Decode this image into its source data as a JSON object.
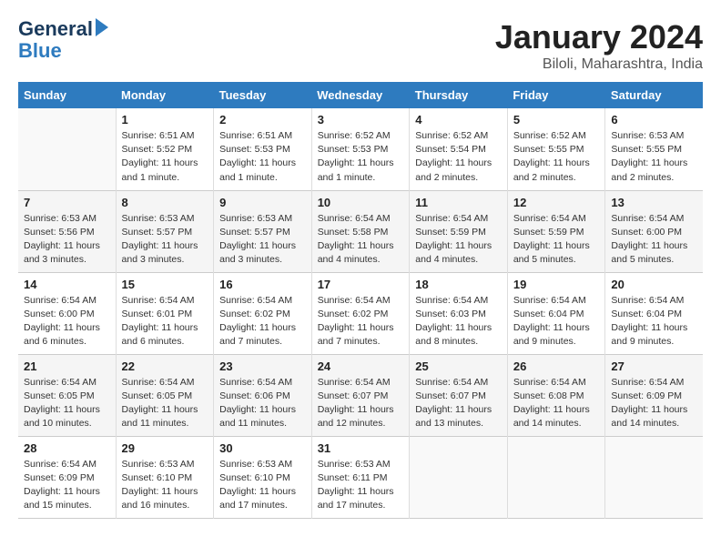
{
  "logo": {
    "line1": "General",
    "line2": "Blue"
  },
  "title": "January 2024",
  "subtitle": "Biloli, Maharashtra, India",
  "headers": [
    "Sunday",
    "Monday",
    "Tuesday",
    "Wednesday",
    "Thursday",
    "Friday",
    "Saturday"
  ],
  "weeks": [
    [
      {
        "day": "",
        "info": ""
      },
      {
        "day": "1",
        "info": "Sunrise: 6:51 AM\nSunset: 5:52 PM\nDaylight: 11 hours\nand 1 minute."
      },
      {
        "day": "2",
        "info": "Sunrise: 6:51 AM\nSunset: 5:53 PM\nDaylight: 11 hours\nand 1 minute."
      },
      {
        "day": "3",
        "info": "Sunrise: 6:52 AM\nSunset: 5:53 PM\nDaylight: 11 hours\nand 1 minute."
      },
      {
        "day": "4",
        "info": "Sunrise: 6:52 AM\nSunset: 5:54 PM\nDaylight: 11 hours\nand 2 minutes."
      },
      {
        "day": "5",
        "info": "Sunrise: 6:52 AM\nSunset: 5:55 PM\nDaylight: 11 hours\nand 2 minutes."
      },
      {
        "day": "6",
        "info": "Sunrise: 6:53 AM\nSunset: 5:55 PM\nDaylight: 11 hours\nand 2 minutes."
      }
    ],
    [
      {
        "day": "7",
        "info": "Sunrise: 6:53 AM\nSunset: 5:56 PM\nDaylight: 11 hours\nand 3 minutes."
      },
      {
        "day": "8",
        "info": "Sunrise: 6:53 AM\nSunset: 5:57 PM\nDaylight: 11 hours\nand 3 minutes."
      },
      {
        "day": "9",
        "info": "Sunrise: 6:53 AM\nSunset: 5:57 PM\nDaylight: 11 hours\nand 3 minutes."
      },
      {
        "day": "10",
        "info": "Sunrise: 6:54 AM\nSunset: 5:58 PM\nDaylight: 11 hours\nand 4 minutes."
      },
      {
        "day": "11",
        "info": "Sunrise: 6:54 AM\nSunset: 5:59 PM\nDaylight: 11 hours\nand 4 minutes."
      },
      {
        "day": "12",
        "info": "Sunrise: 6:54 AM\nSunset: 5:59 PM\nDaylight: 11 hours\nand 5 minutes."
      },
      {
        "day": "13",
        "info": "Sunrise: 6:54 AM\nSunset: 6:00 PM\nDaylight: 11 hours\nand 5 minutes."
      }
    ],
    [
      {
        "day": "14",
        "info": "Sunrise: 6:54 AM\nSunset: 6:00 PM\nDaylight: 11 hours\nand 6 minutes."
      },
      {
        "day": "15",
        "info": "Sunrise: 6:54 AM\nSunset: 6:01 PM\nDaylight: 11 hours\nand 6 minutes."
      },
      {
        "day": "16",
        "info": "Sunrise: 6:54 AM\nSunset: 6:02 PM\nDaylight: 11 hours\nand 7 minutes."
      },
      {
        "day": "17",
        "info": "Sunrise: 6:54 AM\nSunset: 6:02 PM\nDaylight: 11 hours\nand 7 minutes."
      },
      {
        "day": "18",
        "info": "Sunrise: 6:54 AM\nSunset: 6:03 PM\nDaylight: 11 hours\nand 8 minutes."
      },
      {
        "day": "19",
        "info": "Sunrise: 6:54 AM\nSunset: 6:04 PM\nDaylight: 11 hours\nand 9 minutes."
      },
      {
        "day": "20",
        "info": "Sunrise: 6:54 AM\nSunset: 6:04 PM\nDaylight: 11 hours\nand 9 minutes."
      }
    ],
    [
      {
        "day": "21",
        "info": "Sunrise: 6:54 AM\nSunset: 6:05 PM\nDaylight: 11 hours\nand 10 minutes."
      },
      {
        "day": "22",
        "info": "Sunrise: 6:54 AM\nSunset: 6:05 PM\nDaylight: 11 hours\nand 11 minutes."
      },
      {
        "day": "23",
        "info": "Sunrise: 6:54 AM\nSunset: 6:06 PM\nDaylight: 11 hours\nand 11 minutes."
      },
      {
        "day": "24",
        "info": "Sunrise: 6:54 AM\nSunset: 6:07 PM\nDaylight: 11 hours\nand 12 minutes."
      },
      {
        "day": "25",
        "info": "Sunrise: 6:54 AM\nSunset: 6:07 PM\nDaylight: 11 hours\nand 13 minutes."
      },
      {
        "day": "26",
        "info": "Sunrise: 6:54 AM\nSunset: 6:08 PM\nDaylight: 11 hours\nand 14 minutes."
      },
      {
        "day": "27",
        "info": "Sunrise: 6:54 AM\nSunset: 6:09 PM\nDaylight: 11 hours\nand 14 minutes."
      }
    ],
    [
      {
        "day": "28",
        "info": "Sunrise: 6:54 AM\nSunset: 6:09 PM\nDaylight: 11 hours\nand 15 minutes."
      },
      {
        "day": "29",
        "info": "Sunrise: 6:53 AM\nSunset: 6:10 PM\nDaylight: 11 hours\nand 16 minutes."
      },
      {
        "day": "30",
        "info": "Sunrise: 6:53 AM\nSunset: 6:10 PM\nDaylight: 11 hours\nand 17 minutes."
      },
      {
        "day": "31",
        "info": "Sunrise: 6:53 AM\nSunset: 6:11 PM\nDaylight: 11 hours\nand 17 minutes."
      },
      {
        "day": "",
        "info": ""
      },
      {
        "day": "",
        "info": ""
      },
      {
        "day": "",
        "info": ""
      }
    ]
  ]
}
